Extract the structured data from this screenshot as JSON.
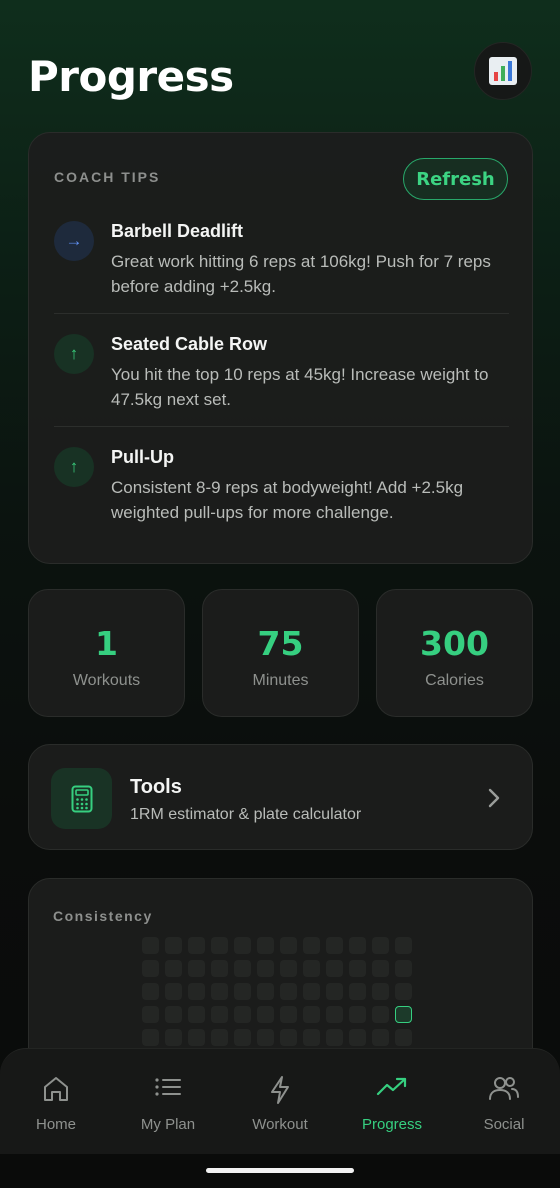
{
  "header": {
    "title": "Progress",
    "chart_icon": "bar-chart-icon"
  },
  "coach_tips": {
    "heading": "COACH TIPS",
    "refresh_label": "Refresh",
    "tips": [
      {
        "icon": "arrow-right-icon",
        "exercise": "Barbell Deadlift",
        "message": "Great work hitting 6 reps at 106kg! Push for 7 reps before adding +2.5kg."
      },
      {
        "icon": "arrow-up-icon",
        "exercise": "Seated Cable Row",
        "message": "You hit the top 10 reps at 45kg! Increase weight to 47.5kg next set."
      },
      {
        "icon": "arrow-up-icon",
        "exercise": "Pull-Up",
        "message": "Consistent 8-9 reps at bodyweight! Add +2.5kg weighted pull-ups for more challenge."
      }
    ]
  },
  "stats": [
    {
      "value": "1",
      "label": "Workouts"
    },
    {
      "value": "75",
      "label": "Minutes"
    },
    {
      "value": "300",
      "label": "Calories"
    }
  ],
  "tools": {
    "icon": "calculator-icon",
    "title": "Tools",
    "subtitle": "1RM estimator & plate calculator"
  },
  "consistency": {
    "title": "Consistency",
    "active_cell": {
      "row": 3,
      "col": 11
    }
  },
  "nav": [
    {
      "label": "Home",
      "icon": "home-icon",
      "active": false
    },
    {
      "label": "My Plan",
      "icon": "list-icon",
      "active": false
    },
    {
      "label": "Workout",
      "icon": "lightning-icon",
      "active": false
    },
    {
      "label": "Progress",
      "icon": "trending-up-icon",
      "active": true
    },
    {
      "label": "Social",
      "icon": "people-icon",
      "active": false
    }
  ],
  "colors": {
    "accent": "#36cf80",
    "neutral_tip": "#5f8ff0"
  }
}
